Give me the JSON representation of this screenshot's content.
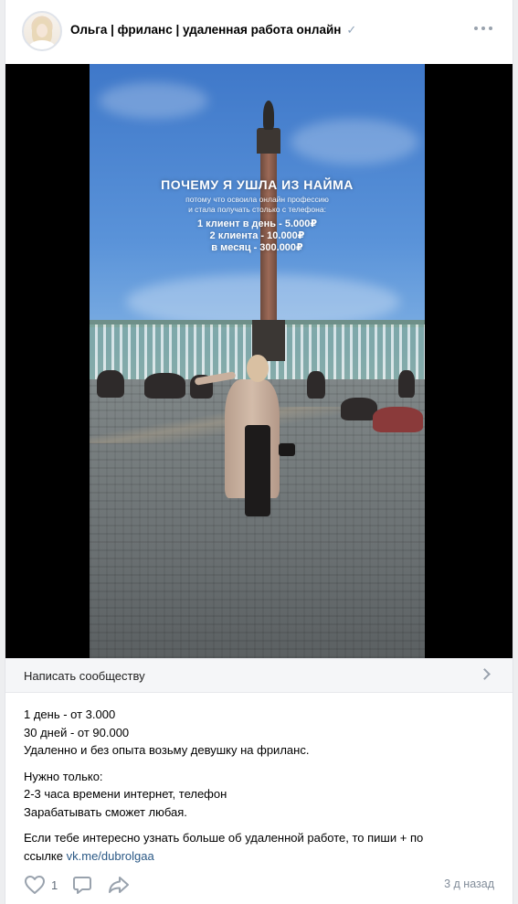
{
  "post": {
    "author": "Ольга | фриланс | удаленная работа онлайн",
    "verified_mark": "✓",
    "video_overlay": {
      "title": "ПОЧЕМУ Я УШЛА ИЗ НАЙМА",
      "subtitle_1": "потому что освоила онлайн профессию",
      "subtitle_2": "и стала получать столько с телефона:",
      "line_1": "1 клиент в день - 5.000₽",
      "line_2": "2 клиента - 10.000₽",
      "line_3": "в месяц - 300.000₽"
    },
    "message_button": "Написать сообществу",
    "text": {
      "p1": [
        "1 день - от 3.000",
        "30 дней - от 90.000",
        "Удаленно и без опыта возьму девушку на фриланс."
      ],
      "p2": [
        "Нужно только:",
        "2-3 часа времени интернет, телефон",
        "Зарабатывать сможет любая."
      ],
      "p3_line1": "Если тебе интересно узнать больше об удаленной работе, то пиши + по",
      "p3_prefix": "ссылке",
      "p3_link": "vk.me/dubrolgaa"
    },
    "likes_count": "1",
    "timestamp": "3 д назад"
  },
  "icons": {
    "more": "more-horizontal-icon",
    "chevron": "chevron-right-icon",
    "like": "heart-icon",
    "comment": "comment-icon",
    "share": "share-icon"
  },
  "colors": {
    "link": "#2a5885",
    "muted": "#818c99",
    "icon": "#99a2ad"
  }
}
